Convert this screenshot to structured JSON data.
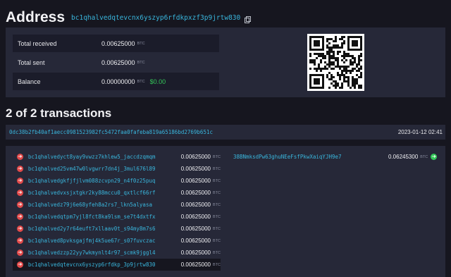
{
  "header": {
    "title": "Address",
    "address": "bc1qhalvedqtevcnx6yszyp6rfdkpxzf3p9jrtw830"
  },
  "summary": {
    "unit": "BTC",
    "rows": [
      {
        "label": "Total received",
        "value": "0.00625000"
      },
      {
        "label": "Total sent",
        "value": "0.00625000"
      },
      {
        "label": "Balance",
        "value": "0.00000000",
        "usd": "$0.00"
      }
    ]
  },
  "transactions_title": "2 of 2 transactions",
  "transaction": {
    "txid": "0dc38b2fb40af1aecc0981523982fc5472faa0fafeba819a65186bd2769b651c",
    "time": "2023-01-12 02:41",
    "inputs": [
      {
        "address": "bc1qhalvedyct8yay9vwzz7khlew5_jaccdzqmqm",
        "amount": "0.00625000"
      },
      {
        "address": "bc1qhalved25vm47w0lvgwrr7dn4j_3mul676l89",
        "amount": "0.00625000"
      },
      {
        "address": "bc1qhalvedgkfjfjlvm088zcvpn29_n4f0z25puq",
        "amount": "0.00625000"
      },
      {
        "address": "bc1qhalvedvxsjxtgkr2ky88mccu0_qxtlcf66rf",
        "amount": "0.00625000"
      },
      {
        "address": "bc1qhalvedz79j6e68yfeh8a2rs7_lkn5alyasa",
        "amount": "0.00625000"
      },
      {
        "address": "bc1qhalvedqtpm7yjl8fct8ka9lsm_se7t4dxtfx",
        "amount": "0.00625000"
      },
      {
        "address": "bc1qhalved2y7r64euft7xllaav0t_s94my8m7s6",
        "amount": "0.00625000"
      },
      {
        "address": "bc1qhalved8pvksgajfmj4k5ue67r_s07fuvczac",
        "amount": "0.00625000"
      },
      {
        "address": "bc1qhalvedzzp22yy7wkmynlt4r97_scmk9jggl4",
        "amount": "0.00625000"
      },
      {
        "address": "bc1qhalvedqtevcnx6yszyp6rfdkp_3p9jrtw830",
        "amount": "0.00625000"
      }
    ],
    "outputs": [
      {
        "address": "38BNmksdPw63ghuNEeFsfPkwXaiqYJH9e7",
        "amount": "0.06245300"
      }
    ]
  },
  "icons": {
    "input_arrow": "arrow-right-icon-red",
    "output_arrow": "arrow-right-icon-green",
    "copy": "copy-icon"
  },
  "colors": {
    "link": "#39b6dd",
    "panel": "#262838",
    "background": "#16161f",
    "input_arrow": "#e24a4a",
    "output_arrow": "#34c759"
  }
}
